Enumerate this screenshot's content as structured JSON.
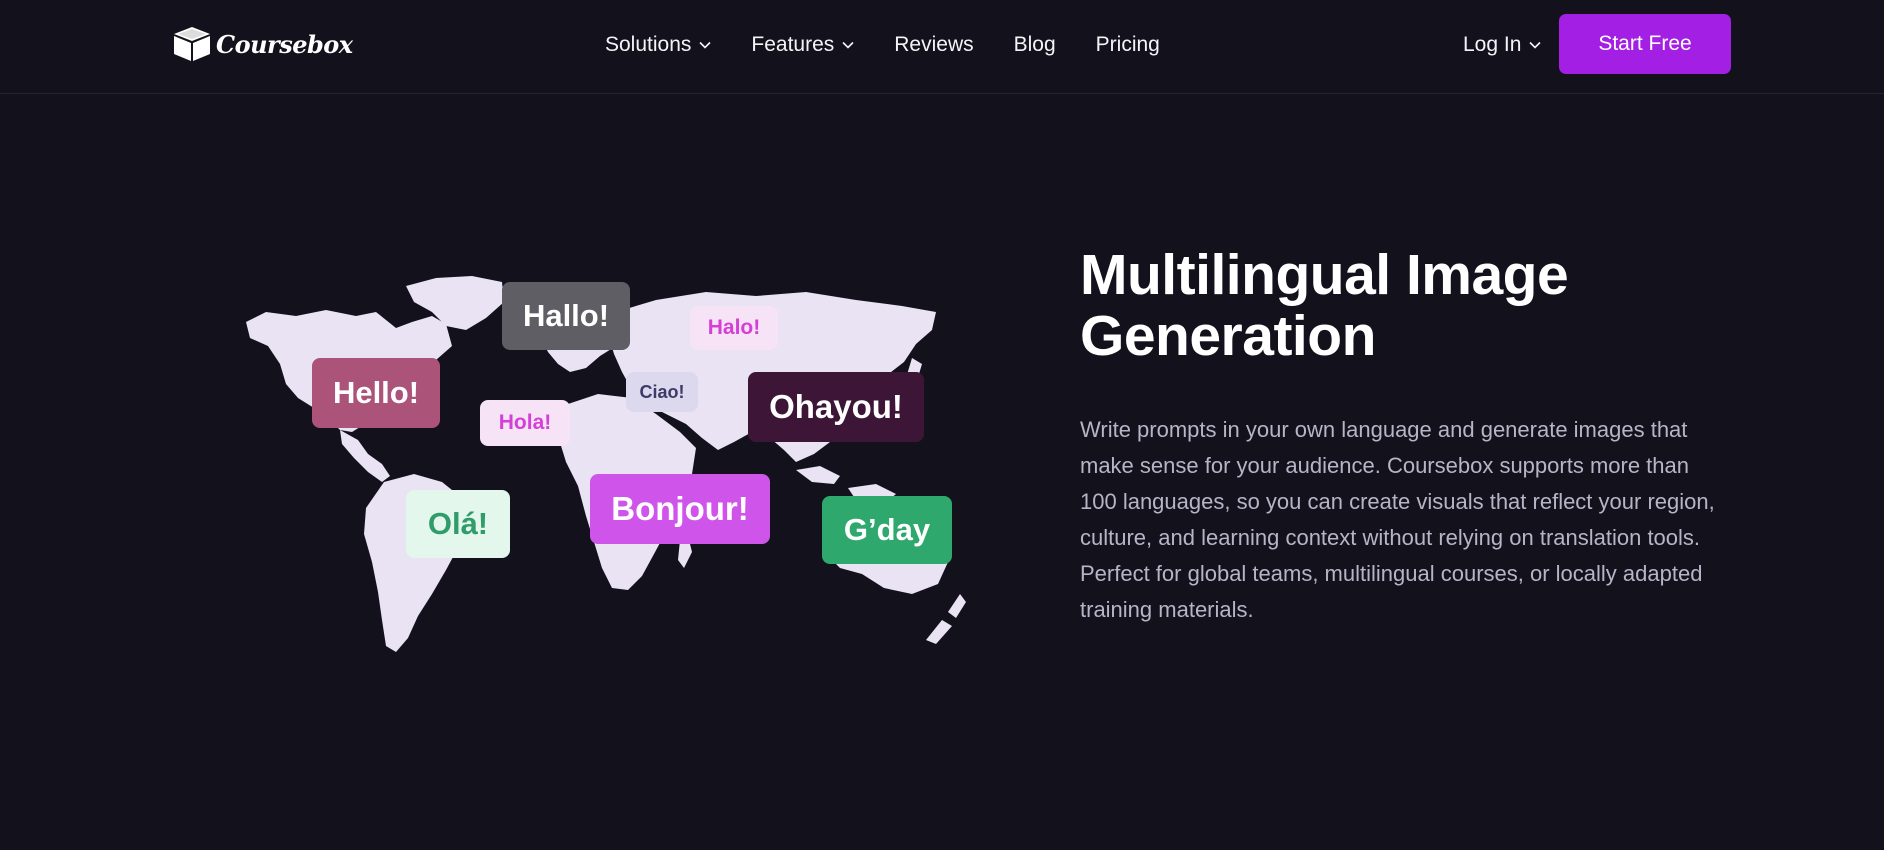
{
  "header": {
    "logo_text": "Coursebox",
    "nav": [
      {
        "label": "Solutions",
        "dropdown": true
      },
      {
        "label": "Features",
        "dropdown": true
      },
      {
        "label": "Reviews",
        "dropdown": false
      },
      {
        "label": "Blog",
        "dropdown": false
      },
      {
        "label": "Pricing",
        "dropdown": false
      }
    ],
    "login_label": "Log In",
    "cta_label": "Start Free"
  },
  "hero": {
    "title": "Multilingual Image Generation",
    "description": "Write prompts in your own language and generate images that make sense for your audience. Coursebox supports more than 100 languages, so you can create visuals that reflect your region, culture, and learning context without relying on translation tools. Perfect for global teams, multilingual courses, or locally adapted training materials."
  },
  "map_greetings": {
    "hallo": "Hallo!",
    "halo": "Halo!",
    "hello": "Hello!",
    "ciao": "Ciao!",
    "hola": "Hola!",
    "ohayou": "Ohayou!",
    "ola": "Olá!",
    "bonjour": "Bonjour!",
    "gday": "G’day"
  },
  "colors": {
    "background": "#13121c",
    "accent": "#a21fe3",
    "map_land": "#e9e3f3"
  }
}
